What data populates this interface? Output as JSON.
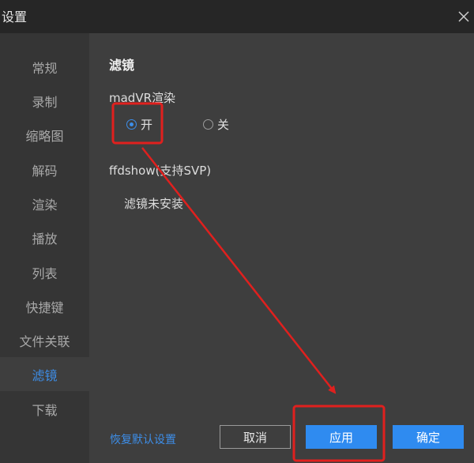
{
  "window": {
    "title": "设置"
  },
  "sidebar": {
    "items": [
      {
        "label": "常规"
      },
      {
        "label": "录制"
      },
      {
        "label": "缩略图"
      },
      {
        "label": "解码"
      },
      {
        "label": "渲染"
      },
      {
        "label": "播放"
      },
      {
        "label": "列表"
      },
      {
        "label": "快捷键"
      },
      {
        "label": "文件关联"
      },
      {
        "label": "滤镜"
      },
      {
        "label": "下载"
      }
    ],
    "active_item": "滤镜"
  },
  "content": {
    "section_title": "滤镜",
    "madvr": {
      "label": "madVR渲染",
      "on_label": "开",
      "off_label": "关",
      "selected": "开"
    },
    "ffdshow": {
      "label": "ffdshow(支持SVP)",
      "status": "滤镜未安装"
    }
  },
  "footer": {
    "restore_label": "恢复默认设置",
    "cancel_label": "取消",
    "apply_label": "应用",
    "ok_label": "确定"
  },
  "icons": {
    "close": "close-icon"
  },
  "colors": {
    "accent": "#3d8ee8",
    "annotation": "#e0201e",
    "titlebar": "#262626",
    "sidebar": "#353535",
    "content": "#3e3e3e"
  }
}
